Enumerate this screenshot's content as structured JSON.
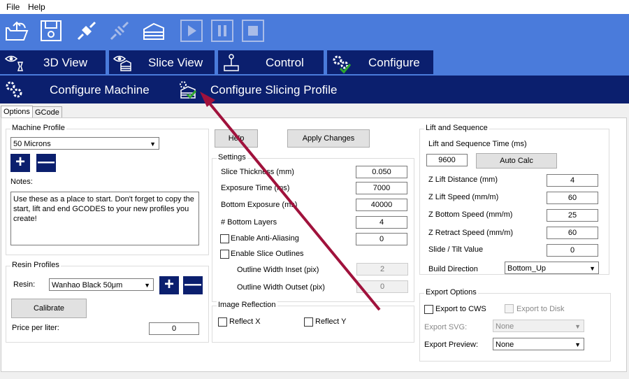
{
  "menu": {
    "file": "File",
    "help": "Help"
  },
  "toolbar": {
    "icons": [
      "open-folder-icon",
      "save-icon",
      "connect-icon",
      "disconnect-icon",
      "slice-icon",
      "play-icon",
      "pause-icon",
      "stop-icon"
    ]
  },
  "main_tabs": {
    "view3d": "3D View",
    "slice_view": "Slice View",
    "control": "Control",
    "configure": "Configure"
  },
  "sub_tabs": {
    "machine": "Configure Machine",
    "slicing": "Configure Slicing Profile"
  },
  "inner_tabs": {
    "options": "Options",
    "gcode": "GCode"
  },
  "machine_profile": {
    "title": "Machine Profile",
    "selected": "50 Microns",
    "add": "+",
    "remove": "—",
    "notes_label": "Notes:",
    "notes": "Use these as a place to start. Don't forget to copy the start, lift and end GCODES to your new profiles you create!"
  },
  "resin_profiles": {
    "title": "Resin Profiles",
    "resin_label": "Resin:",
    "resin_selected": "Wanhao Black 50μm",
    "add": "+",
    "remove": "—",
    "calibrate": "Calibrate",
    "price_label": "Price per liter:",
    "price": "0"
  },
  "buttons": {
    "help": "Help",
    "apply": "Apply Changes"
  },
  "settings": {
    "title": "Settings",
    "slice_thickness_label": "Slice Thickness (mm)",
    "slice_thickness": "0.050",
    "exposure_time_label": "Exposure Time (ms)",
    "exposure_time": "7000",
    "bottom_exposure_label": "Bottom Exposure (ms)",
    "bottom_exposure": "40000",
    "bottom_layers_label": "# Bottom Layers",
    "bottom_layers": "4",
    "anti_aliasing_label": "Enable Anti-Aliasing",
    "anti_aliasing": "0",
    "slice_outlines_label": "Enable Slice Outlines",
    "outline_inset_label": "Outline Width Inset (pix)",
    "outline_inset": "2",
    "outline_outset_label": "Outline Width Outset (pix)",
    "outline_outset": "0"
  },
  "image_reflection": {
    "title": "Image Reflection",
    "reflect_x": "Reflect X",
    "reflect_y": "Reflect Y"
  },
  "lift": {
    "title": "Lift and Sequence",
    "time_label": "Lift and Sequence Time (ms)",
    "time": "9600",
    "auto_calc": "Auto Calc",
    "z_lift_distance_label": "Z Lift Distance (mm)",
    "z_lift_distance": "4",
    "z_lift_speed_label": "Z Lift Speed (mm/m)",
    "z_lift_speed": "60",
    "z_bottom_speed_label": "Z Bottom Speed (mm/m)",
    "z_bottom_speed": "25",
    "z_retract_speed_label": "Z Retract Speed (mm/m)",
    "z_retract_speed": "60",
    "slide_tilt_label": "Slide / Tilt Value",
    "slide_tilt": "0",
    "build_direction_label": "Build Direction",
    "build_direction": "Bottom_Up"
  },
  "export": {
    "title": "Export Options",
    "to_cws": "Export to CWS",
    "to_disk": "Export to Disk",
    "svg_label": "Export SVG:",
    "svg_value": "None",
    "preview_label": "Export Preview:",
    "preview_value": "None"
  },
  "colors": {
    "toolbar": "#4a7bdb",
    "tab_dark": "#0b1f6e",
    "arrow": "#a0123c",
    "check_green": "#2ea62e"
  }
}
